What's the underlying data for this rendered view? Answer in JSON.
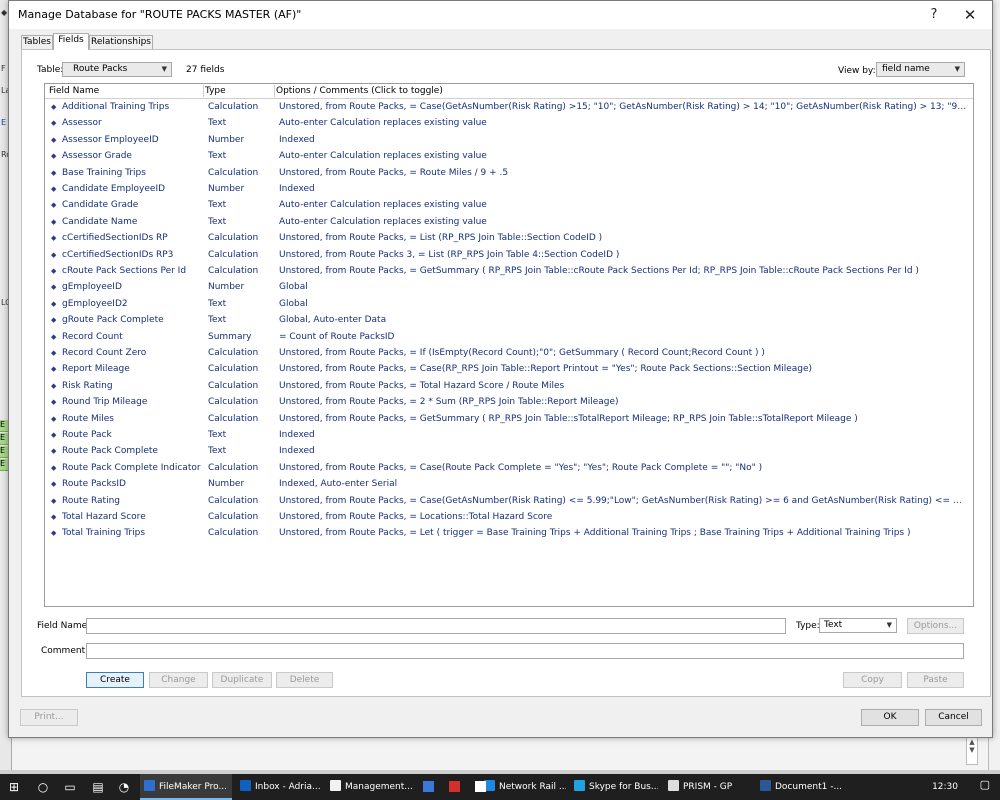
{
  "dialog": {
    "title": "Manage Database for \"ROUTE PACKS MASTER (AF)\"",
    "help": "?",
    "close": "✕"
  },
  "tabs": [
    "Tables",
    "Fields",
    "Relationships"
  ],
  "table_label": "Table:",
  "table_value": "Route Packs",
  "field_count": "27 fields",
  "viewby_label": "View by:",
  "viewby_value": "field name",
  "columns": {
    "name": "Field Name",
    "type": "Type",
    "options": "Options / Comments   (Click to toggle)"
  },
  "fields": [
    {
      "name": "Additional Training Trips",
      "type": "Calculation",
      "options": "Unstored, from Route Packs, = Case(GetAsNumber(Risk Rating) >15; \"10\"; GetAsNumber(Risk Rating) > 14; \"10\"; GetAsNumber(Risk Rating) > 13; \"9\"; GetAsNumber(Risk R..."
    },
    {
      "name": "Assessor",
      "type": "Text",
      "options": "Auto-enter Calculation replaces existing value"
    },
    {
      "name": "Assessor EmployeeID",
      "type": "Number",
      "options": "Indexed"
    },
    {
      "name": "Assessor Grade",
      "type": "Text",
      "options": "Auto-enter Calculation replaces existing value"
    },
    {
      "name": "Base Training Trips",
      "type": "Calculation",
      "options": "Unstored, from Route Packs, = Route Miles / 9 + .5"
    },
    {
      "name": "Candidate EmployeeID",
      "type": "Number",
      "options": "Indexed"
    },
    {
      "name": "Candidate Grade",
      "type": "Text",
      "options": "Auto-enter Calculation replaces existing value"
    },
    {
      "name": "Candidate Name",
      "type": "Text",
      "options": "Auto-enter Calculation replaces existing value"
    },
    {
      "name": "cCertifiedSectionIDs RP",
      "type": "Calculation",
      "options": "Unstored, from Route Packs, =  List (RP_RPS Join Table::Section CodeID )"
    },
    {
      "name": "cCertifiedSectionIDs RP3",
      "type": "Calculation",
      "options": "Unstored, from Route Packs 3, =  List (RP_RPS Join Table 4::Section CodeID )"
    },
    {
      "name": "cRoute Pack Sections Per Id",
      "type": "Calculation",
      "options": "Unstored, from Route Packs, = GetSummary ( RP_RPS Join Table::cRoute Pack Sections Per Id; RP_RPS Join Table::cRoute Pack Sections Per Id )"
    },
    {
      "name": "gEmployeeID",
      "type": "Number",
      "options": "Global"
    },
    {
      "name": "gEmployeeID2",
      "type": "Text",
      "options": "Global"
    },
    {
      "name": "gRoute Pack Complete",
      "type": "Text",
      "options": "Global, Auto-enter Data"
    },
    {
      "name": "Record Count",
      "type": "Summary",
      "options": "= Count of Route PacksID"
    },
    {
      "name": "Record Count Zero",
      "type": "Calculation",
      "options": "Unstored, from Route Packs, = If (IsEmpty(Record Count);\"0\"; GetSummary ( Record Count;Record Count ) )"
    },
    {
      "name": "Report Mileage",
      "type": "Calculation",
      "options": "Unstored, from Route Packs, = Case(RP_RPS Join Table::Report Printout = \"Yes\"; Route Pack Sections::Section Mileage)"
    },
    {
      "name": "Risk Rating",
      "type": "Calculation",
      "options": "Unstored, from Route Packs, = Total Hazard Score / Route Miles"
    },
    {
      "name": "Round Trip Mileage",
      "type": "Calculation",
      "options": "Unstored, from Route Packs, = 2 * Sum (RP_RPS Join Table::Report Mileage)"
    },
    {
      "name": "Route Miles",
      "type": "Calculation",
      "options": "Unstored, from Route Packs, = GetSummary ( RP_RPS Join Table::sTotalReport Mileage; RP_RPS Join Table::sTotalReport Mileage )"
    },
    {
      "name": "Route Pack",
      "type": "Text",
      "options": "Indexed"
    },
    {
      "name": "Route Pack Complete",
      "type": "Text",
      "options": "Indexed"
    },
    {
      "name": "Route Pack Complete Indicator",
      "type": "Calculation",
      "options": "Unstored, from Route Packs, = Case(Route Pack Complete = \"Yes\"; \"Yes\"; Route Pack Complete = \"\"; \"No\" )"
    },
    {
      "name": "Route PacksID",
      "type": "Number",
      "options": "Indexed, Auto-enter Serial"
    },
    {
      "name": "Route Rating",
      "type": "Calculation",
      "options": "Unstored, from Route Packs, = Case(GetAsNumber(Risk Rating) <= 5.99;\"Low\"; GetAsNumber(Risk Rating) >= 6 and GetAsNumber(Risk Rating) <= 10.99;\"Med\";GetAsNum..."
    },
    {
      "name": "Total Hazard Score",
      "type": "Calculation",
      "options": "Unstored, from Route Packs, = Locations::Total Hazard Score"
    },
    {
      "name": "Total Training Trips",
      "type": "Calculation",
      "options": "Unstored, from Route Packs, = Let (   trigger = Base Training Trips + Additional Training Trips ; Base Training Trips + Additional Training Trips )"
    }
  ],
  "form": {
    "field_name_label": "Field Name:",
    "field_name_value": "",
    "type_label": "Type:",
    "type_value": "Text",
    "options_button": "Options...",
    "comment_label": "Comment:",
    "comment_value": ""
  },
  "buttons": {
    "create": "Create",
    "change": "Change",
    "duplicate": "Duplicate",
    "delete": "Delete",
    "copy": "Copy",
    "paste": "Paste",
    "print": "Print...",
    "ok": "OK",
    "cancel": "Cancel"
  },
  "taskbar": {
    "apps": [
      {
        "label": "FileMaker Pro...",
        "color": "#2f6fd1"
      },
      {
        "label": "Inbox - Adria...",
        "color": "#1060c0"
      },
      {
        "label": "Management...",
        "color": "#f2f2f2"
      },
      {
        "label": "Network Rail ...",
        "color": "#1e88e5"
      },
      {
        "label": "Skype for Bus...",
        "color": "#1fa2e0"
      },
      {
        "label": "PRISM - GP",
        "color": "#dddddd"
      },
      {
        "label": "Document1 -...",
        "color": "#2b5797"
      }
    ],
    "time": "12:30"
  },
  "background": {
    "left_marks": [
      "F",
      "La",
      "E",
      "Ro",
      "LO"
    ],
    "green_marks": [
      "E",
      "E",
      "E",
      "E"
    ],
    "scroll_marks": [
      "▲",
      "▼"
    ]
  }
}
